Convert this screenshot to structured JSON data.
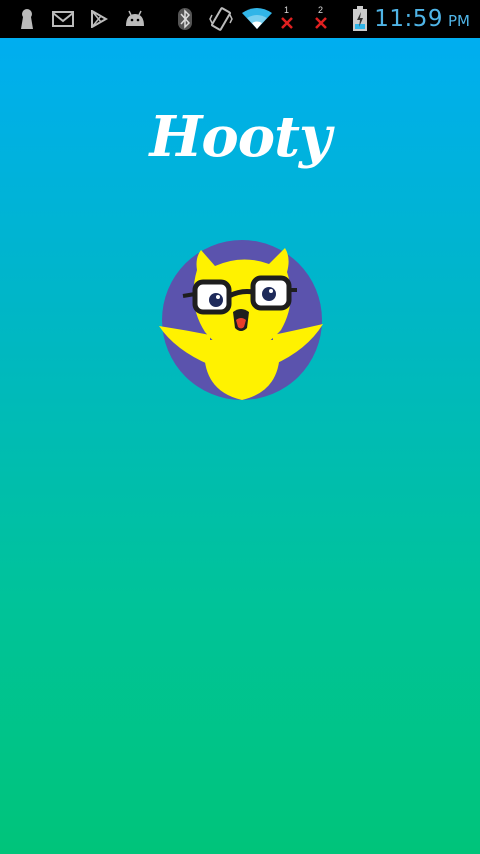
{
  "status_bar": {
    "time": "11:59",
    "ampm": "PM",
    "sim1_label": "1",
    "sim2_label": "2",
    "icons": [
      "keyhole-icon",
      "gmail-icon",
      "play-store-icon",
      "android-icon",
      "bluetooth-icon",
      "vibrate-icon",
      "wifi-icon",
      "no-signal-icon",
      "no-signal-icon",
      "battery-charging-icon"
    ]
  },
  "app": {
    "title": "Hooty",
    "mascot_icon": "owl-mascot-icon"
  },
  "colors": {
    "gradient_top": "#00aef0",
    "gradient_bottom": "#00c47a",
    "mascot_circle": "#5b53ad",
    "mascot_body": "#fff200",
    "clock": "#4fb4e6"
  }
}
